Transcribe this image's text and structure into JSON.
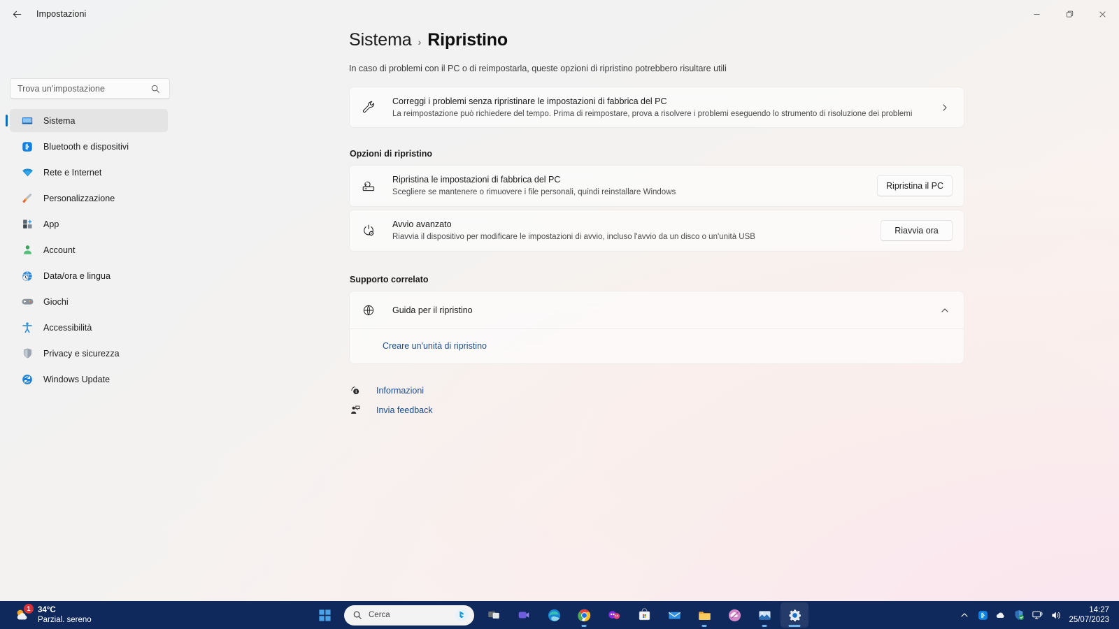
{
  "window": {
    "title": "Impostazioni",
    "back_icon": "back-arrow-icon",
    "minimize_label": "—",
    "maximize_label": "❐",
    "close_label": "✕"
  },
  "sidebar": {
    "search": {
      "placeholder": "Trova un'impostazione",
      "value": ""
    },
    "items": [
      {
        "label": "Sistema",
        "icon": "monitor-icon",
        "selected": true
      },
      {
        "label": "Bluetooth e dispositivi",
        "icon": "bluetooth-icon",
        "selected": false
      },
      {
        "label": "Rete e Internet",
        "icon": "wifi-icon",
        "selected": false
      },
      {
        "label": "Personalizzazione",
        "icon": "paintbrush-icon",
        "selected": false
      },
      {
        "label": "App",
        "icon": "apps-icon",
        "selected": false
      },
      {
        "label": "Account",
        "icon": "person-icon",
        "selected": false
      },
      {
        "label": "Data/ora e lingua",
        "icon": "clock-globe-icon",
        "selected": false
      },
      {
        "label": "Giochi",
        "icon": "gamepad-icon",
        "selected": false
      },
      {
        "label": "Accessibilità",
        "icon": "accessibility-icon",
        "selected": false
      },
      {
        "label": "Privacy e sicurezza",
        "icon": "shield-icon",
        "selected": false
      },
      {
        "label": "Windows Update",
        "icon": "update-icon",
        "selected": false
      }
    ]
  },
  "main": {
    "breadcrumb": {
      "parent": "Sistema",
      "separator": "›",
      "current": "Ripristino"
    },
    "description": "In caso di problemi con il PC o di reimpostarla, queste opzioni di ripristino potrebbero risultare utili",
    "troubleshoot": {
      "icon": "wrench-icon",
      "title": "Correggi i problemi senza ripristinare le impostazioni di fabbrica del PC",
      "subtitle": "La reimpostazione può richiedere del tempo. Prima di reimpostare, prova a risolvere i problemi eseguendo lo strumento di risoluzione dei problemi",
      "chevron": "chevron-right-icon"
    },
    "recovery_section": {
      "heading": "Opzioni di ripristino",
      "rows": [
        {
          "icon": "reset-pc-icon",
          "title": "Ripristina le impostazioni di fabbrica del PC",
          "subtitle": "Scegliere se mantenere o rimuovere i file personali, quindi reinstallare Windows",
          "button": "Ripristina il PC"
        },
        {
          "icon": "power-gear-icon",
          "title": "Avvio avanzato",
          "subtitle": "Riavvia il dispositivo per modificare le impostazioni di avvio, incluso l'avvio da un disco o un'unità USB",
          "button": "Riavvia ora"
        }
      ]
    },
    "support_section": {
      "heading": "Supporto correlato",
      "expander": {
        "icon": "globe-icon",
        "title": "Guida per il ripristino",
        "chevron": "chevron-up-icon",
        "expanded": true
      },
      "links": [
        {
          "label": "Creare un'unità di ripristino"
        }
      ]
    },
    "footer_links": [
      {
        "label": "Informazioni",
        "icon": "info-help-icon"
      },
      {
        "label": "Invia feedback",
        "icon": "feedback-icon"
      }
    ]
  },
  "taskbar": {
    "weather": {
      "temperature": "34°C",
      "condition": "Parzial. sereno",
      "badge": "1",
      "icon": "partly-cloudy-icon"
    },
    "start": {
      "icon": "windows-start-icon"
    },
    "search": {
      "placeholder": "Cerca",
      "icon": "search-icon",
      "assistant_icon": "bing-chat-icon"
    },
    "apps": [
      {
        "name": "task-view",
        "icon": "task-view-icon",
        "running": false,
        "active": false
      },
      {
        "name": "microsoft-teams",
        "icon": "teams-icon",
        "running": false,
        "active": false
      },
      {
        "name": "microsoft-edge",
        "icon": "edge-icon",
        "running": false,
        "active": false
      },
      {
        "name": "google-chrome",
        "icon": "chrome-icon",
        "running": true,
        "active": false
      },
      {
        "name": "messenger",
        "icon": "messenger-icon",
        "running": false,
        "active": false
      },
      {
        "name": "microsoft-store",
        "icon": "store-icon",
        "running": false,
        "active": false
      },
      {
        "name": "mail",
        "icon": "mail-icon",
        "running": false,
        "active": false
      },
      {
        "name": "file-explorer",
        "icon": "folder-icon",
        "running": true,
        "active": false
      },
      {
        "name": "onedrive",
        "icon": "onedrive-app-icon",
        "running": false,
        "active": false
      },
      {
        "name": "photos",
        "icon": "photos-icon",
        "running": true,
        "active": false
      },
      {
        "name": "settings",
        "icon": "settings-gear-icon",
        "running": true,
        "active": true
      }
    ],
    "tray": {
      "overflow_icon": "chevron-up-icon",
      "icons": [
        {
          "name": "bluetooth-tray-icon"
        },
        {
          "name": "onedrive-tray-icon"
        },
        {
          "name": "security-tray-icon"
        },
        {
          "name": "network-tray-icon"
        },
        {
          "name": "volume-tray-icon"
        }
      ],
      "time": "14:27",
      "date": "25/07/2023"
    }
  }
}
